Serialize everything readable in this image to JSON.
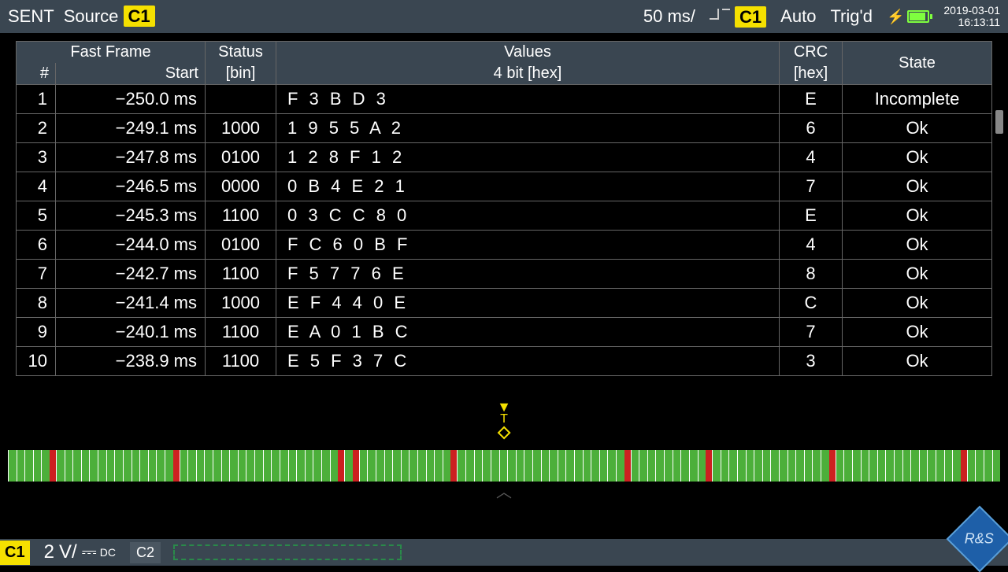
{
  "top": {
    "protocol": "SENT",
    "source_label": "Source",
    "source_channel": "C1",
    "timebase": "50 ms/",
    "trigger_channel": "C1",
    "trigger_mode": "Auto",
    "trigger_state": "Trig'd",
    "date": "2019-03-01",
    "time": "16:13:11"
  },
  "headers": {
    "fast_frame": "Fast Frame",
    "num": "#",
    "start": "Start",
    "status": "Status",
    "status_sub": "[bin]",
    "values": "Values",
    "values_sub": "4 bit [hex]",
    "crc": "CRC",
    "crc_sub": "[hex]",
    "state": "State"
  },
  "rows": [
    {
      "n": "1",
      "start": "−250.0 ms",
      "status": "",
      "values": "F3BD3",
      "crc": "E",
      "state": "Incomplete"
    },
    {
      "n": "2",
      "start": "−249.1 ms",
      "status": "1000",
      "values": "1955A2",
      "crc": "6",
      "state": "Ok"
    },
    {
      "n": "3",
      "start": "−247.8 ms",
      "status": "0100",
      "values": "128F12",
      "crc": "4",
      "state": "Ok"
    },
    {
      "n": "4",
      "start": "−246.5 ms",
      "status": "0000",
      "values": "0B4E21",
      "crc": "7",
      "state": "Ok"
    },
    {
      "n": "5",
      "start": "−245.3 ms",
      "status": "1100",
      "values": "03CC80",
      "crc": "E",
      "state": "Ok"
    },
    {
      "n": "6",
      "start": "−244.0 ms",
      "status": "0100",
      "values": "FC60BF",
      "crc": "4",
      "state": "Ok"
    },
    {
      "n": "7",
      "start": "−242.7 ms",
      "status": "1100",
      "values": "F5776E",
      "crc": "8",
      "state": "Ok"
    },
    {
      "n": "8",
      "start": "−241.4 ms",
      "status": "1000",
      "values": "EF440E",
      "crc": "C",
      "state": "Ok"
    },
    {
      "n": "9",
      "start": "−240.1 ms",
      "status": "1100",
      "values": "EA01BC",
      "crc": "7",
      "state": "Ok"
    },
    {
      "n": "10",
      "start": "−238.9 ms",
      "status": "1100",
      "values": "E5F37C",
      "crc": "3",
      "state": "Ok"
    }
  ],
  "trigger_marker": {
    "arrow": "▼",
    "label": "T"
  },
  "bottom": {
    "c1": "C1",
    "c1_scale": "2",
    "c1_unit": "V/",
    "c1_coupling": "DC",
    "c2": "C2"
  },
  "logo": "R&S"
}
